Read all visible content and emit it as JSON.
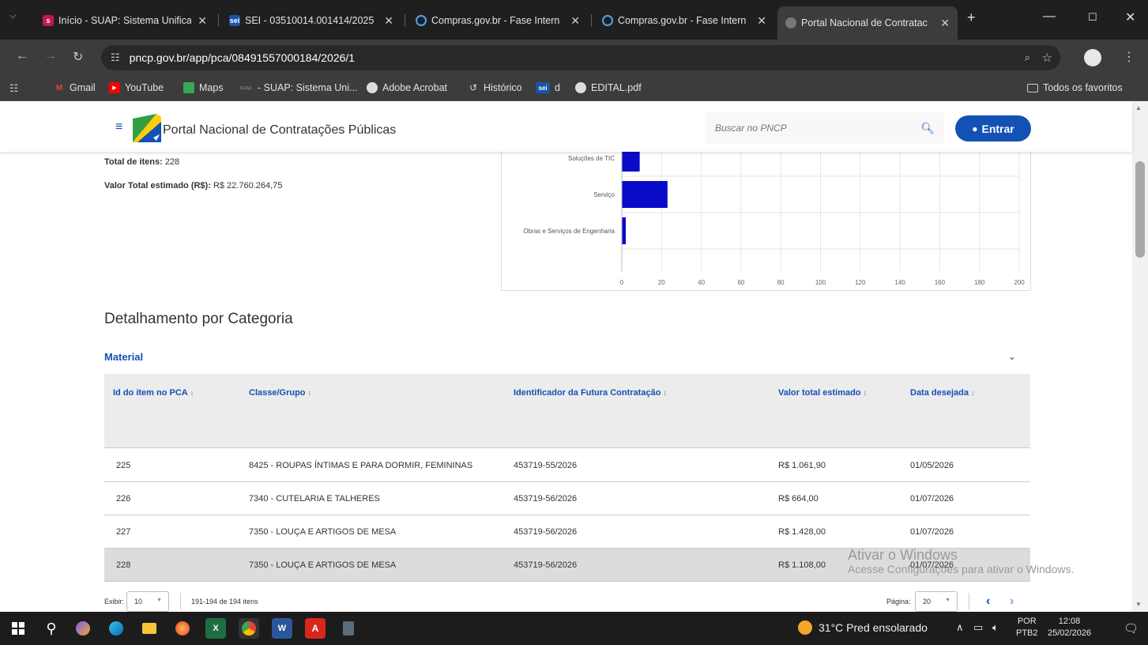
{
  "browser": {
    "tabs": [
      {
        "title": "Início - SUAP: Sistema Unifica",
        "favicon": "suap"
      },
      {
        "title": "SEI - 03510014.001414/2025",
        "favicon": "sei"
      },
      {
        "title": "Compras.gov.br - Fase Intern",
        "favicon": "compras"
      },
      {
        "title": "Compras.gov.br - Fase Intern",
        "favicon": "compras"
      },
      {
        "title": "Portal Nacional de Contratac",
        "favicon": "pncp"
      }
    ],
    "url": "pncp.gov.br/app/pca/08491557000184/2026/1",
    "bookmarks": [
      "Gmail",
      "YouTube",
      "Maps",
      "- SUAP: Sistema Uni...",
      "Adobe Acrobat",
      "Histórico",
      "d",
      "EDITAL.pdf"
    ],
    "all_bookmarks": "Todos os favoritos"
  },
  "site": {
    "title": "Portal Nacional de Contratações Públicas",
    "search_placeholder": "Buscar no PNCP",
    "login_label": "Entrar"
  },
  "summary": {
    "total_itens_label": "Total de itens:",
    "total_itens_value": "228",
    "valor_label": "Valor Total estimado (R$):",
    "valor_value": "R$ 22.760.264,75"
  },
  "chart_data": {
    "type": "bar",
    "orientation": "horizontal",
    "categories": [
      "Soluções de TIC",
      "Serviço",
      "Obras e Serviços de Engenharia"
    ],
    "values": [
      9,
      23,
      2
    ],
    "xlim": [
      0,
      200
    ],
    "xticks": [
      0,
      20,
      40,
      60,
      80,
      100,
      120,
      140,
      160,
      180,
      200
    ],
    "bar_color": "#0a0ac9",
    "grid": true
  },
  "section": {
    "heading": "Detalhamento por Categoria",
    "category": "Material"
  },
  "table": {
    "columns": [
      "Id do item no PCA",
      "Classe/Grupo",
      "Identificador da Futura Contratação",
      "Valor total estimado",
      "Data desejada"
    ],
    "rows": [
      [
        "225",
        "8425 - ROUPAS ÍNTIMAS E PARA DORMIR, FEMININAS",
        "453719-55/2026",
        "R$ 1.061,90",
        "01/05/2026"
      ],
      [
        "226",
        "7340 - CUTELARIA E TALHERES",
        "453719-56/2026",
        "R$ 664,00",
        "01/07/2026"
      ],
      [
        "227",
        "7350 - LOUÇA E ARTIGOS DE MESA",
        "453719-56/2026",
        "R$ 1.428,00",
        "01/07/2026"
      ],
      [
        "228",
        "7350 - LOUÇA E ARTIGOS DE MESA",
        "453719-56/2026",
        "R$ 1.108,00",
        "01/07/2026"
      ]
    ]
  },
  "pagination": {
    "exibir_label": "Exibir:",
    "exibir_value": "10",
    "range_text": "191-194 de 194 itens",
    "pagina_label": "Página:",
    "pagina_value": "20"
  },
  "watermark": {
    "line1": "Ativar o Windows",
    "line2": "Acesse Configurações para ativar o Windows."
  },
  "taskbar": {
    "weather": "31°C  Pred ensolarado",
    "lang1": "POR",
    "lang2": "PTB2",
    "time": "12:08",
    "date": "25/02/2026"
  }
}
